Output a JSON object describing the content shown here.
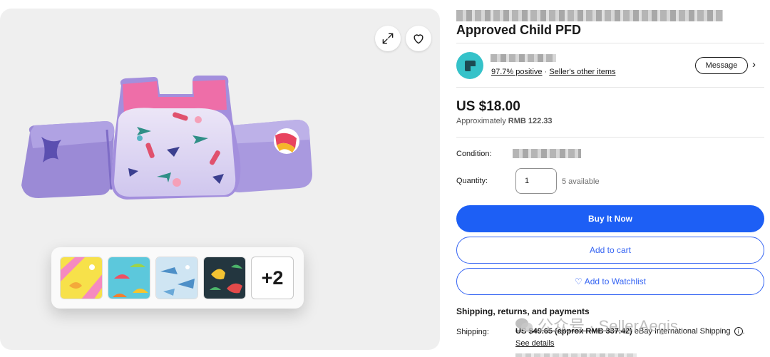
{
  "gallery": {
    "more_count": "+2",
    "icons": {
      "expand": "expand-icon",
      "favorite": "heart-outline-icon"
    }
  },
  "product": {
    "title": "Approved Child PFD"
  },
  "seller": {
    "feedback": "97.7% positive",
    "separator": " · ",
    "other_items": "Seller's other items",
    "message_label": "Message",
    "chevron": "›"
  },
  "pricing": {
    "price": "US $18.00",
    "approx_label": "Approximately",
    "approx_value": "RMB 122.33"
  },
  "item": {
    "condition_label": "Condition:",
    "quantity_label": "Quantity:",
    "quantity_value": "1",
    "available": "5 available"
  },
  "actions": {
    "buy_now": "Buy It Now",
    "add_to_cart": "Add to cart",
    "watchlist_icon": "♡",
    "add_to_watchlist": "Add to Watchlist"
  },
  "shipping": {
    "heading": "Shipping, returns, and payments",
    "label": "Shipping:",
    "amount": "US $49.65 (approx RMB 337.42)",
    "method": " eBay International Shipping",
    "info_icon": "i",
    "tail": ".",
    "see_details": "See details"
  },
  "watermark": {
    "text": "公众号 · SellerAegis"
  },
  "colors": {
    "accent_blue": "#3665f3",
    "buy_button": "#1d5ff5",
    "avatar": "#35c2c9"
  }
}
